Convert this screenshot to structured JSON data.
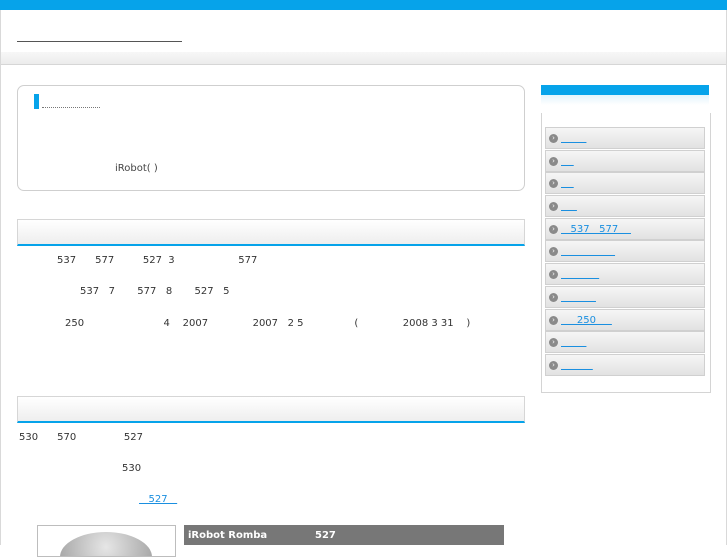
{
  "intro": {
    "text": "iRobot(      )"
  },
  "section1": {
    "lines": [
      "537      577         527  3                    577",
      "537   7       577   8       527   5",
      "250                         4    2007              2007   2 5                (              2008 3 31    )"
    ]
  },
  "section2": {
    "lines": [
      "530      570               527",
      "530"
    ],
    "link": "   527   "
  },
  "product": {
    "col1": "iRobot Romba",
    "col2": "527"
  },
  "sidebar": {
    "items": [
      {
        "label": "        "
      },
      {
        "label": "    "
      },
      {
        "label": "    "
      },
      {
        "label": "     "
      },
      {
        "label": "   537   577    "
      },
      {
        "label": "                 "
      },
      {
        "label": "            "
      },
      {
        "label": "           "
      },
      {
        "label": "     250     "
      },
      {
        "label": "        "
      },
      {
        "label": "          "
      }
    ]
  }
}
